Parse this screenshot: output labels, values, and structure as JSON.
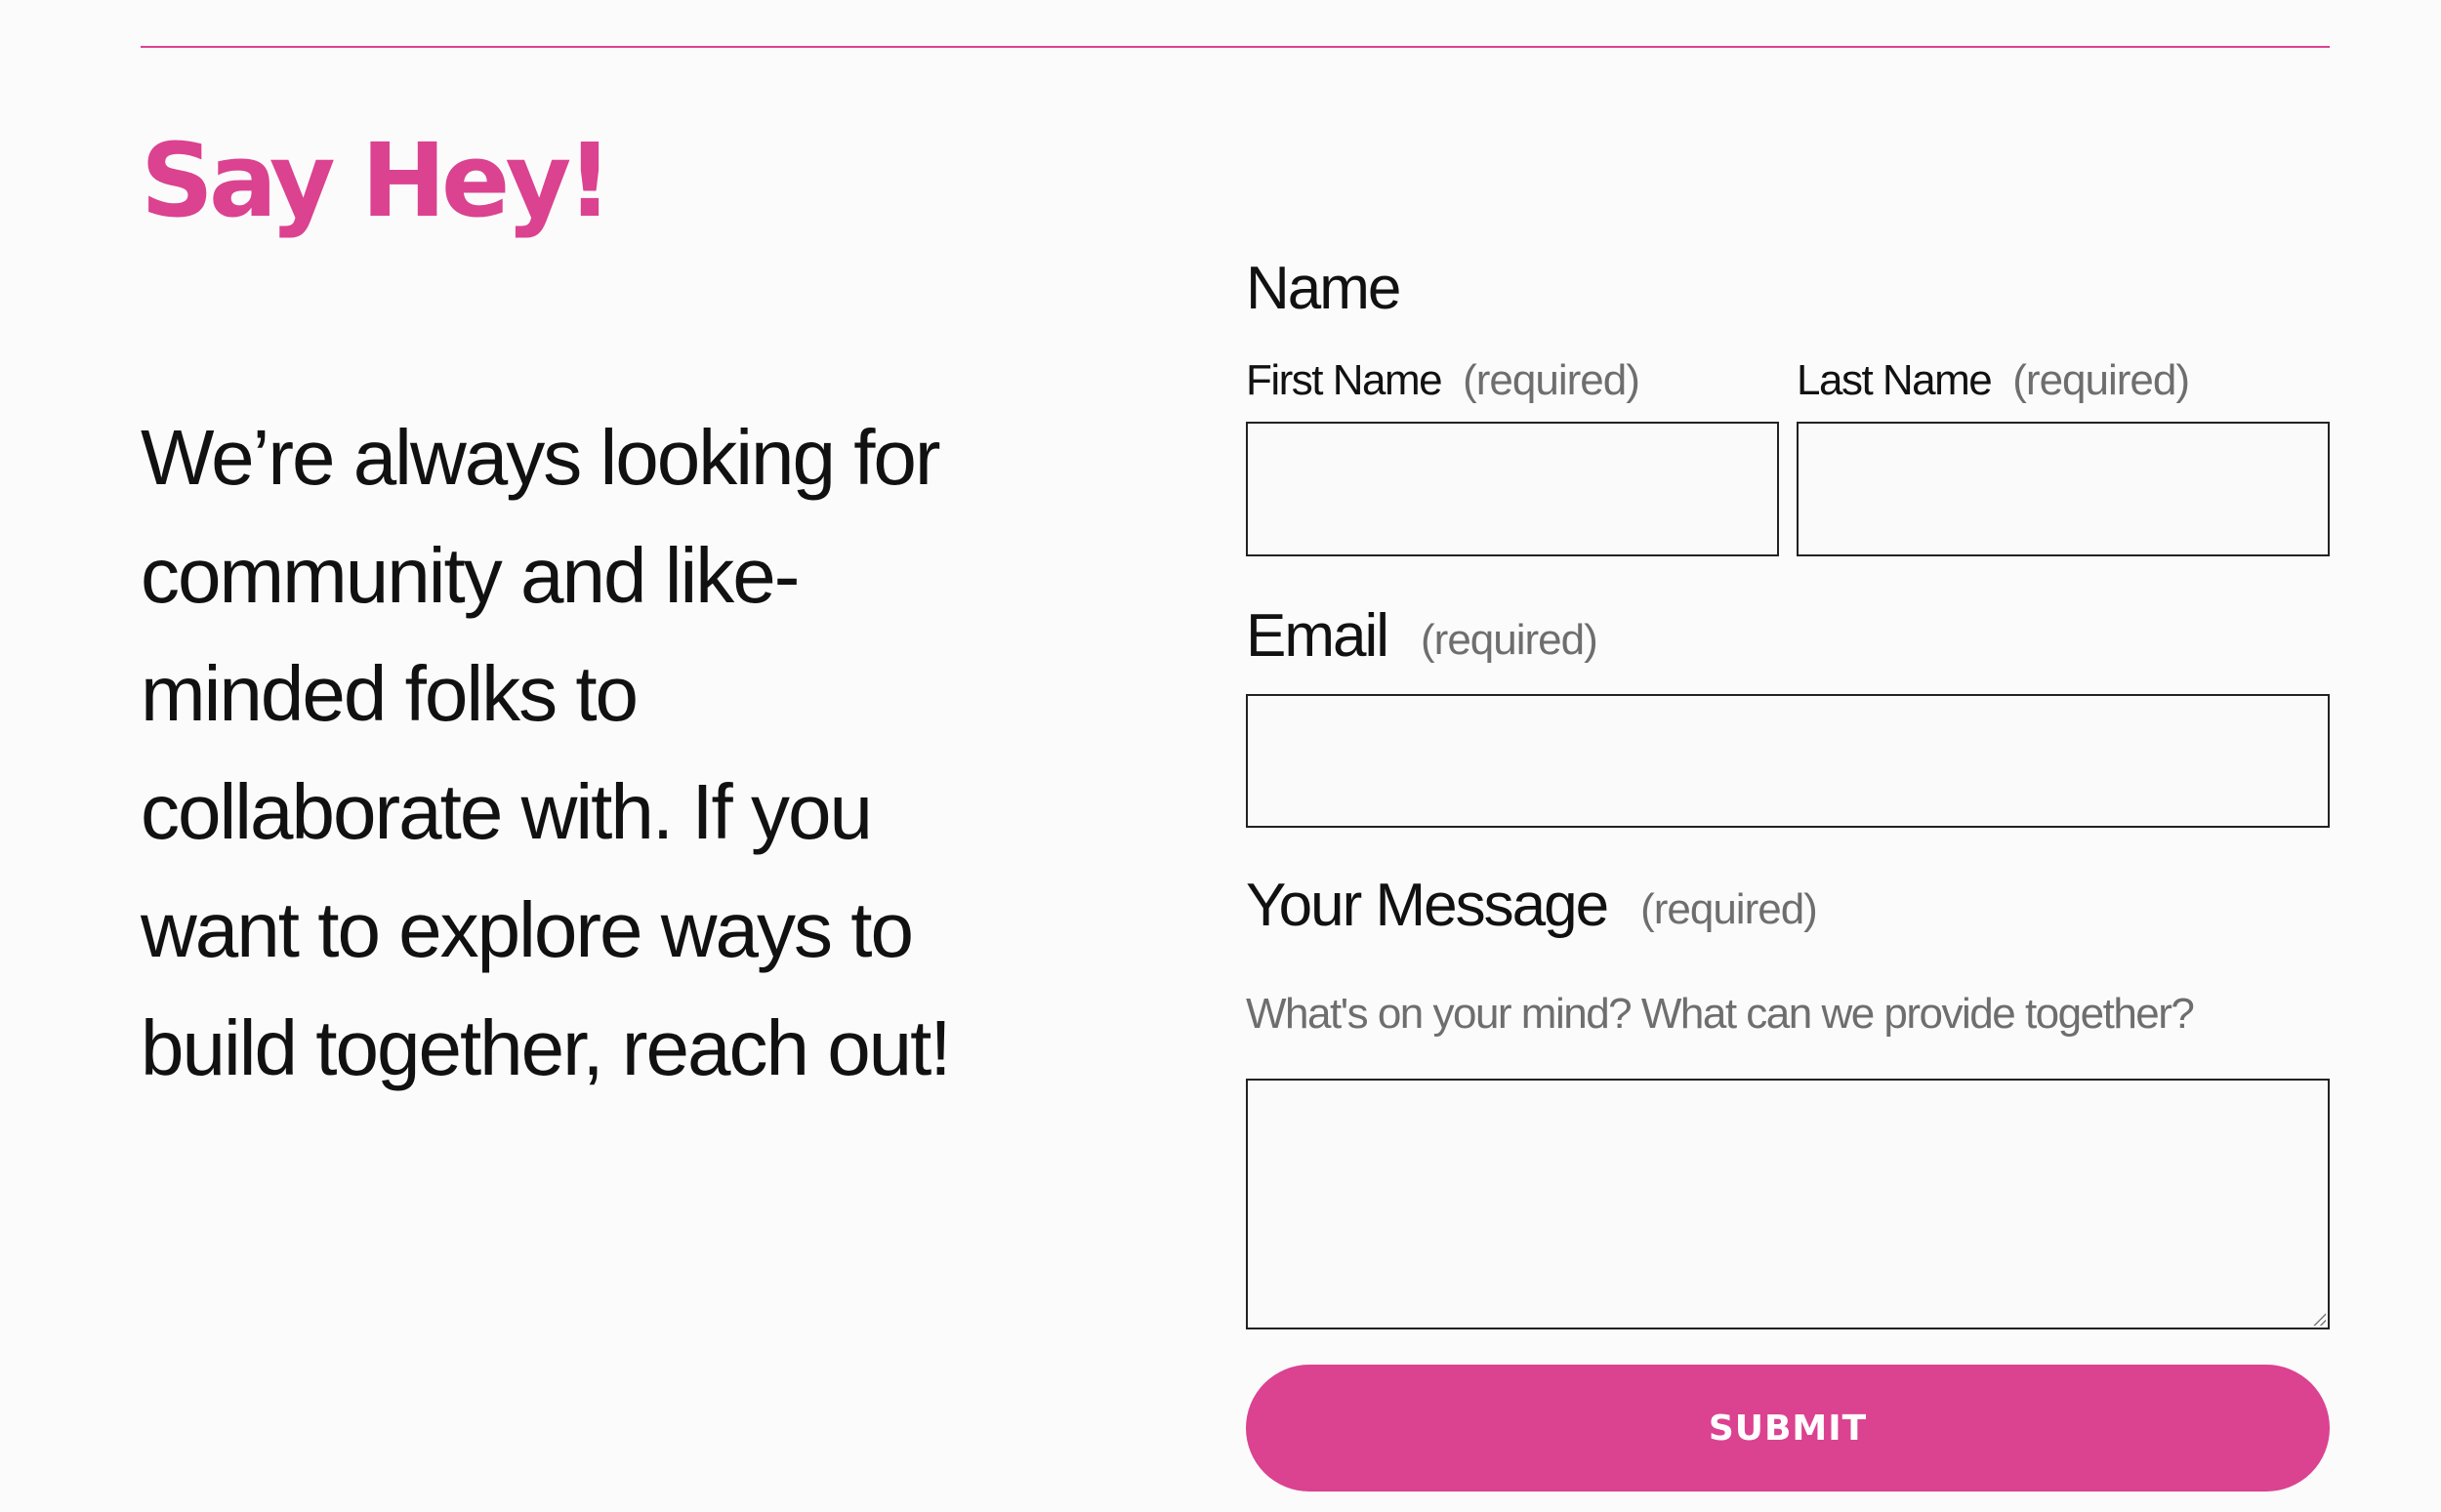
{
  "page": {
    "heading": "Say Hey!",
    "intro": "We’re always looking for community and like-minded folks to collaborate with. If you want to explore ways to build together, reach out!"
  },
  "form": {
    "name_legend": "Name",
    "first_name_label": "First Name",
    "last_name_label": "Last Name",
    "email_label": "Email",
    "message_label": "Your Message",
    "required_marker": "(required)",
    "message_hint": "What's on your mind? What can we provide together?",
    "first_name_value": "",
    "last_name_value": "",
    "email_value": "",
    "message_value": "",
    "submit_label": "SUBMIT"
  },
  "colors": {
    "accent": "#db4290",
    "background": "#fbfbfb",
    "text": "#111111",
    "muted": "#6e6e6e"
  }
}
